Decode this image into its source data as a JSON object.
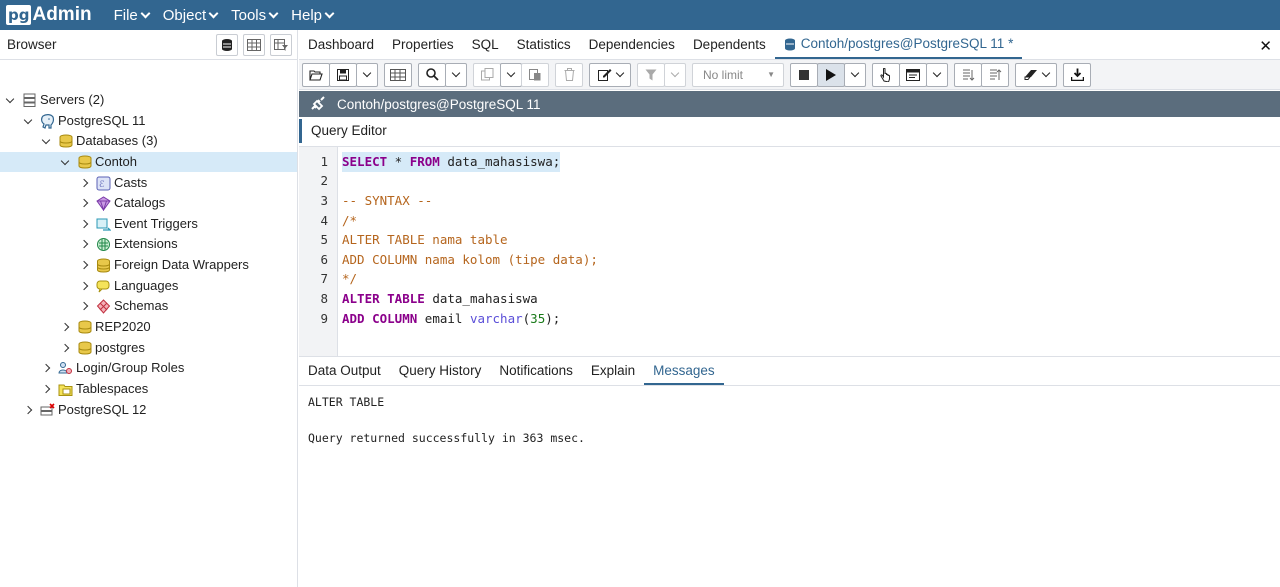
{
  "app": {
    "logo_pg": "pg",
    "logo_admin": "Admin"
  },
  "menu": [
    "File",
    "Object",
    "Tools",
    "Help"
  ],
  "browser": {
    "title": "Browser",
    "tree": [
      {
        "label": "Servers (2)",
        "icon": "servers-icon"
      },
      {
        "label": "PostgreSQL 11",
        "icon": "elephant-icon"
      },
      {
        "label": "Databases (3)",
        "icon": "databases-icon"
      },
      {
        "label": "Contoh",
        "icon": "database-icon"
      },
      {
        "label": "Casts",
        "icon": "casts-icon"
      },
      {
        "label": "Catalogs",
        "icon": "catalogs-icon"
      },
      {
        "label": "Event Triggers",
        "icon": "event-triggers-icon"
      },
      {
        "label": "Extensions",
        "icon": "extensions-icon"
      },
      {
        "label": "Foreign Data Wrappers",
        "icon": "fdw-icon"
      },
      {
        "label": "Languages",
        "icon": "languages-icon"
      },
      {
        "label": "Schemas",
        "icon": "schemas-icon"
      },
      {
        "label": "REP2020",
        "icon": "database-icon"
      },
      {
        "label": "postgres",
        "icon": "database-icon"
      },
      {
        "label": "Login/Group Roles",
        "icon": "roles-icon"
      },
      {
        "label": "Tablespaces",
        "icon": "tablespaces-icon"
      },
      {
        "label": "PostgreSQL 12",
        "icon": "server-disconnected-icon"
      }
    ]
  },
  "tabs": [
    "Dashboard",
    "Properties",
    "SQL",
    "Statistics",
    "Dependencies",
    "Dependents",
    "Contoh/postgres@PostgreSQL 11 *"
  ],
  "toolbar": {
    "limit_label": "No limit"
  },
  "connection": {
    "label": "Contoh/postgres@PostgreSQL 11"
  },
  "editor": {
    "label": "Query Editor",
    "line_numbers": [
      "1",
      "2",
      "3",
      "4",
      "5",
      "6",
      "7",
      "8",
      "9"
    ]
  },
  "bottom_tabs": [
    "Data Output",
    "Query History",
    "Notifications",
    "Explain",
    "Messages"
  ],
  "messages": [
    "ALTER TABLE",
    "Query returned successfully in 363 msec."
  ],
  "colors": {
    "navbar": "#326690",
    "accent": "#326690",
    "selection": "#d6eaf8",
    "connbar": "#5b6d7d"
  }
}
